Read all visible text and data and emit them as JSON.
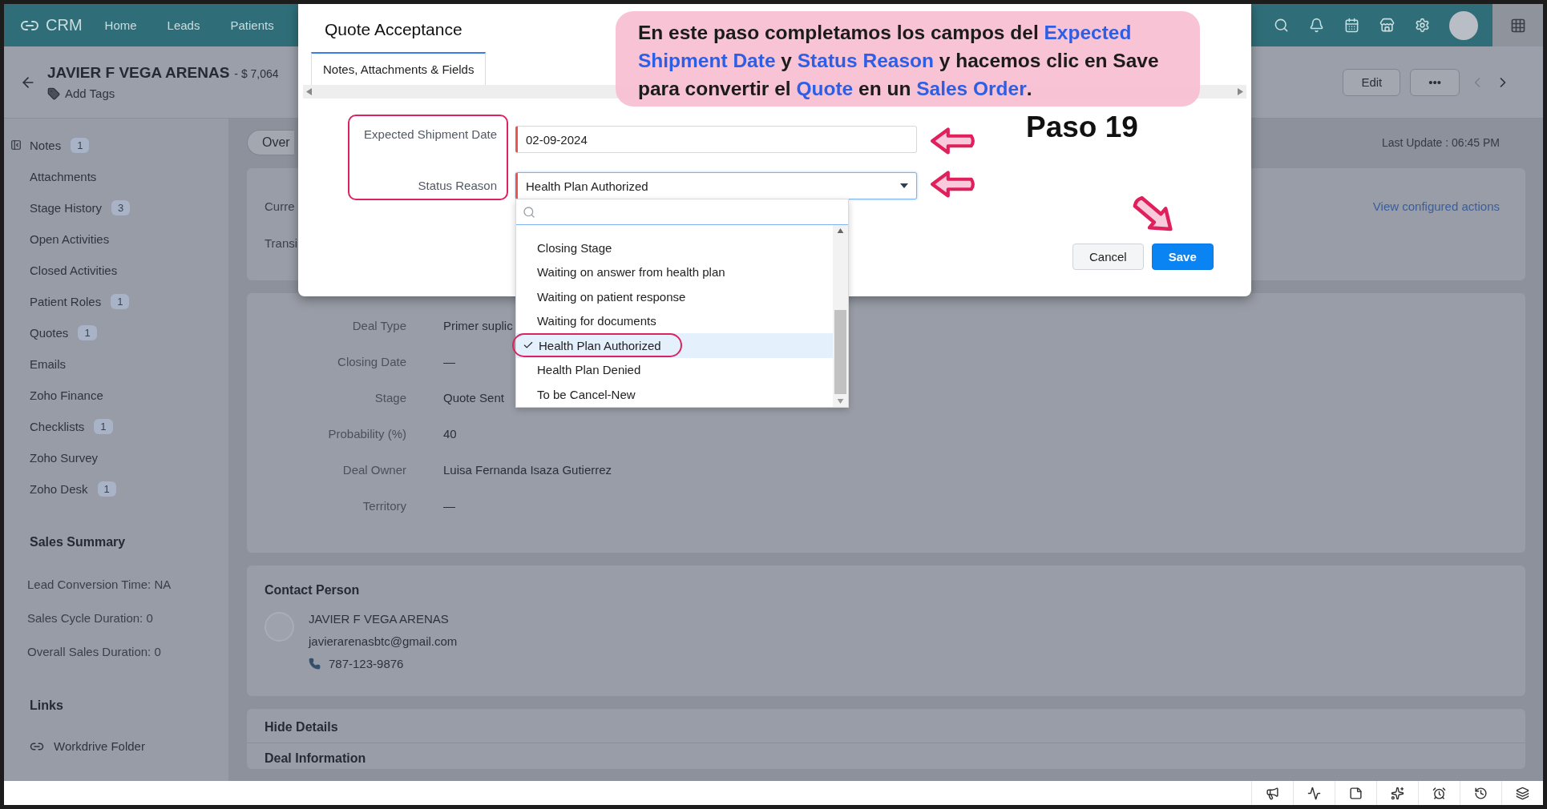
{
  "nav": {
    "logo": "CRM",
    "items": [
      {
        "label": "Home"
      },
      {
        "label": "Leads"
      },
      {
        "label": "Patients"
      }
    ]
  },
  "record": {
    "name": "JAVIER F VEGA ARENAS",
    "amount": "- $ 7,064",
    "add_tags": "Add Tags",
    "edit": "Edit",
    "more": "•••"
  },
  "sidebar": {
    "items": [
      {
        "label": "Notes",
        "count": "1"
      },
      {
        "label": "Attachments"
      },
      {
        "label": "Stage History",
        "count": "3"
      },
      {
        "label": "Open Activities"
      },
      {
        "label": "Closed Activities"
      },
      {
        "label": "Patient Roles",
        "count": "1"
      },
      {
        "label": "Quotes",
        "count": "1"
      },
      {
        "label": "Emails"
      },
      {
        "label": "Zoho Finance"
      },
      {
        "label": "Checklists",
        "count": "1"
      },
      {
        "label": "Zoho Survey"
      },
      {
        "label": "Zoho Desk",
        "count": "1"
      }
    ],
    "sales_summary": {
      "title": "Sales Summary",
      "lines": [
        "Lead Conversion Time: NA",
        "Sales Cycle Duration: 0",
        "Overall Sales Duration: 0"
      ]
    },
    "links": {
      "title": "Links",
      "items": [
        "Workdrive Folder"
      ]
    }
  },
  "overview": {
    "tab": "Over",
    "last_update": "Last Update : 06:45 PM",
    "row_1": "Curre",
    "row_2": "Transi",
    "action_link": "View configured actions"
  },
  "deal_fields": [
    {
      "label": "Deal Type",
      "value": "Primer suplic"
    },
    {
      "label": "Closing Date",
      "value": "—"
    },
    {
      "label": "Stage",
      "value": "Quote Sent"
    },
    {
      "label": "Probability (%)",
      "value": "40"
    },
    {
      "label": "Deal Owner",
      "value": "Luisa Fernanda Isaza Gutierrez"
    },
    {
      "label": "Territory",
      "value": "—"
    }
  ],
  "contact": {
    "title": "Contact Person",
    "name": "JAVIER F VEGA ARENAS",
    "email": "javierarenasbtc@gmail.com",
    "phone": "787-123-9876"
  },
  "details": {
    "title": "Hide Details",
    "section": "Deal Information"
  },
  "modal": {
    "title": "Quote Acceptance",
    "tabs": [
      {
        "label": "Notes, Attachments & Fields",
        "selected": true
      }
    ],
    "fields": [
      {
        "label": "Expected Shipment Date",
        "value": "02-09-2024",
        "kind": "date"
      },
      {
        "label": "Status Reason",
        "value": "Health Plan Authorized",
        "kind": "select"
      }
    ],
    "dropdown": {
      "options": [
        {
          "label": "Closing Stage",
          "selected": false
        },
        {
          "label": "Waiting on answer from health plan",
          "selected": false
        },
        {
          "label": "Waiting on patient response",
          "selected": false
        },
        {
          "label": "Waiting for documents",
          "selected": false
        },
        {
          "label": "Health Plan Authorized",
          "selected": true
        },
        {
          "label": "Health Plan Denied",
          "selected": false
        },
        {
          "label": "To be Cancel-New",
          "selected": false
        }
      ]
    },
    "buttons": [
      {
        "label": "Cancel",
        "kind": "secondary"
      },
      {
        "label": "Save",
        "kind": "primary"
      }
    ]
  },
  "annotation": {
    "text": "En este paso completamos los campos del **Expected Shipment Date** y **Status Reason** y hacemos clic en Save para convertir el **Quote** en un **Sales Order**.",
    "step": "Paso 19"
  }
}
